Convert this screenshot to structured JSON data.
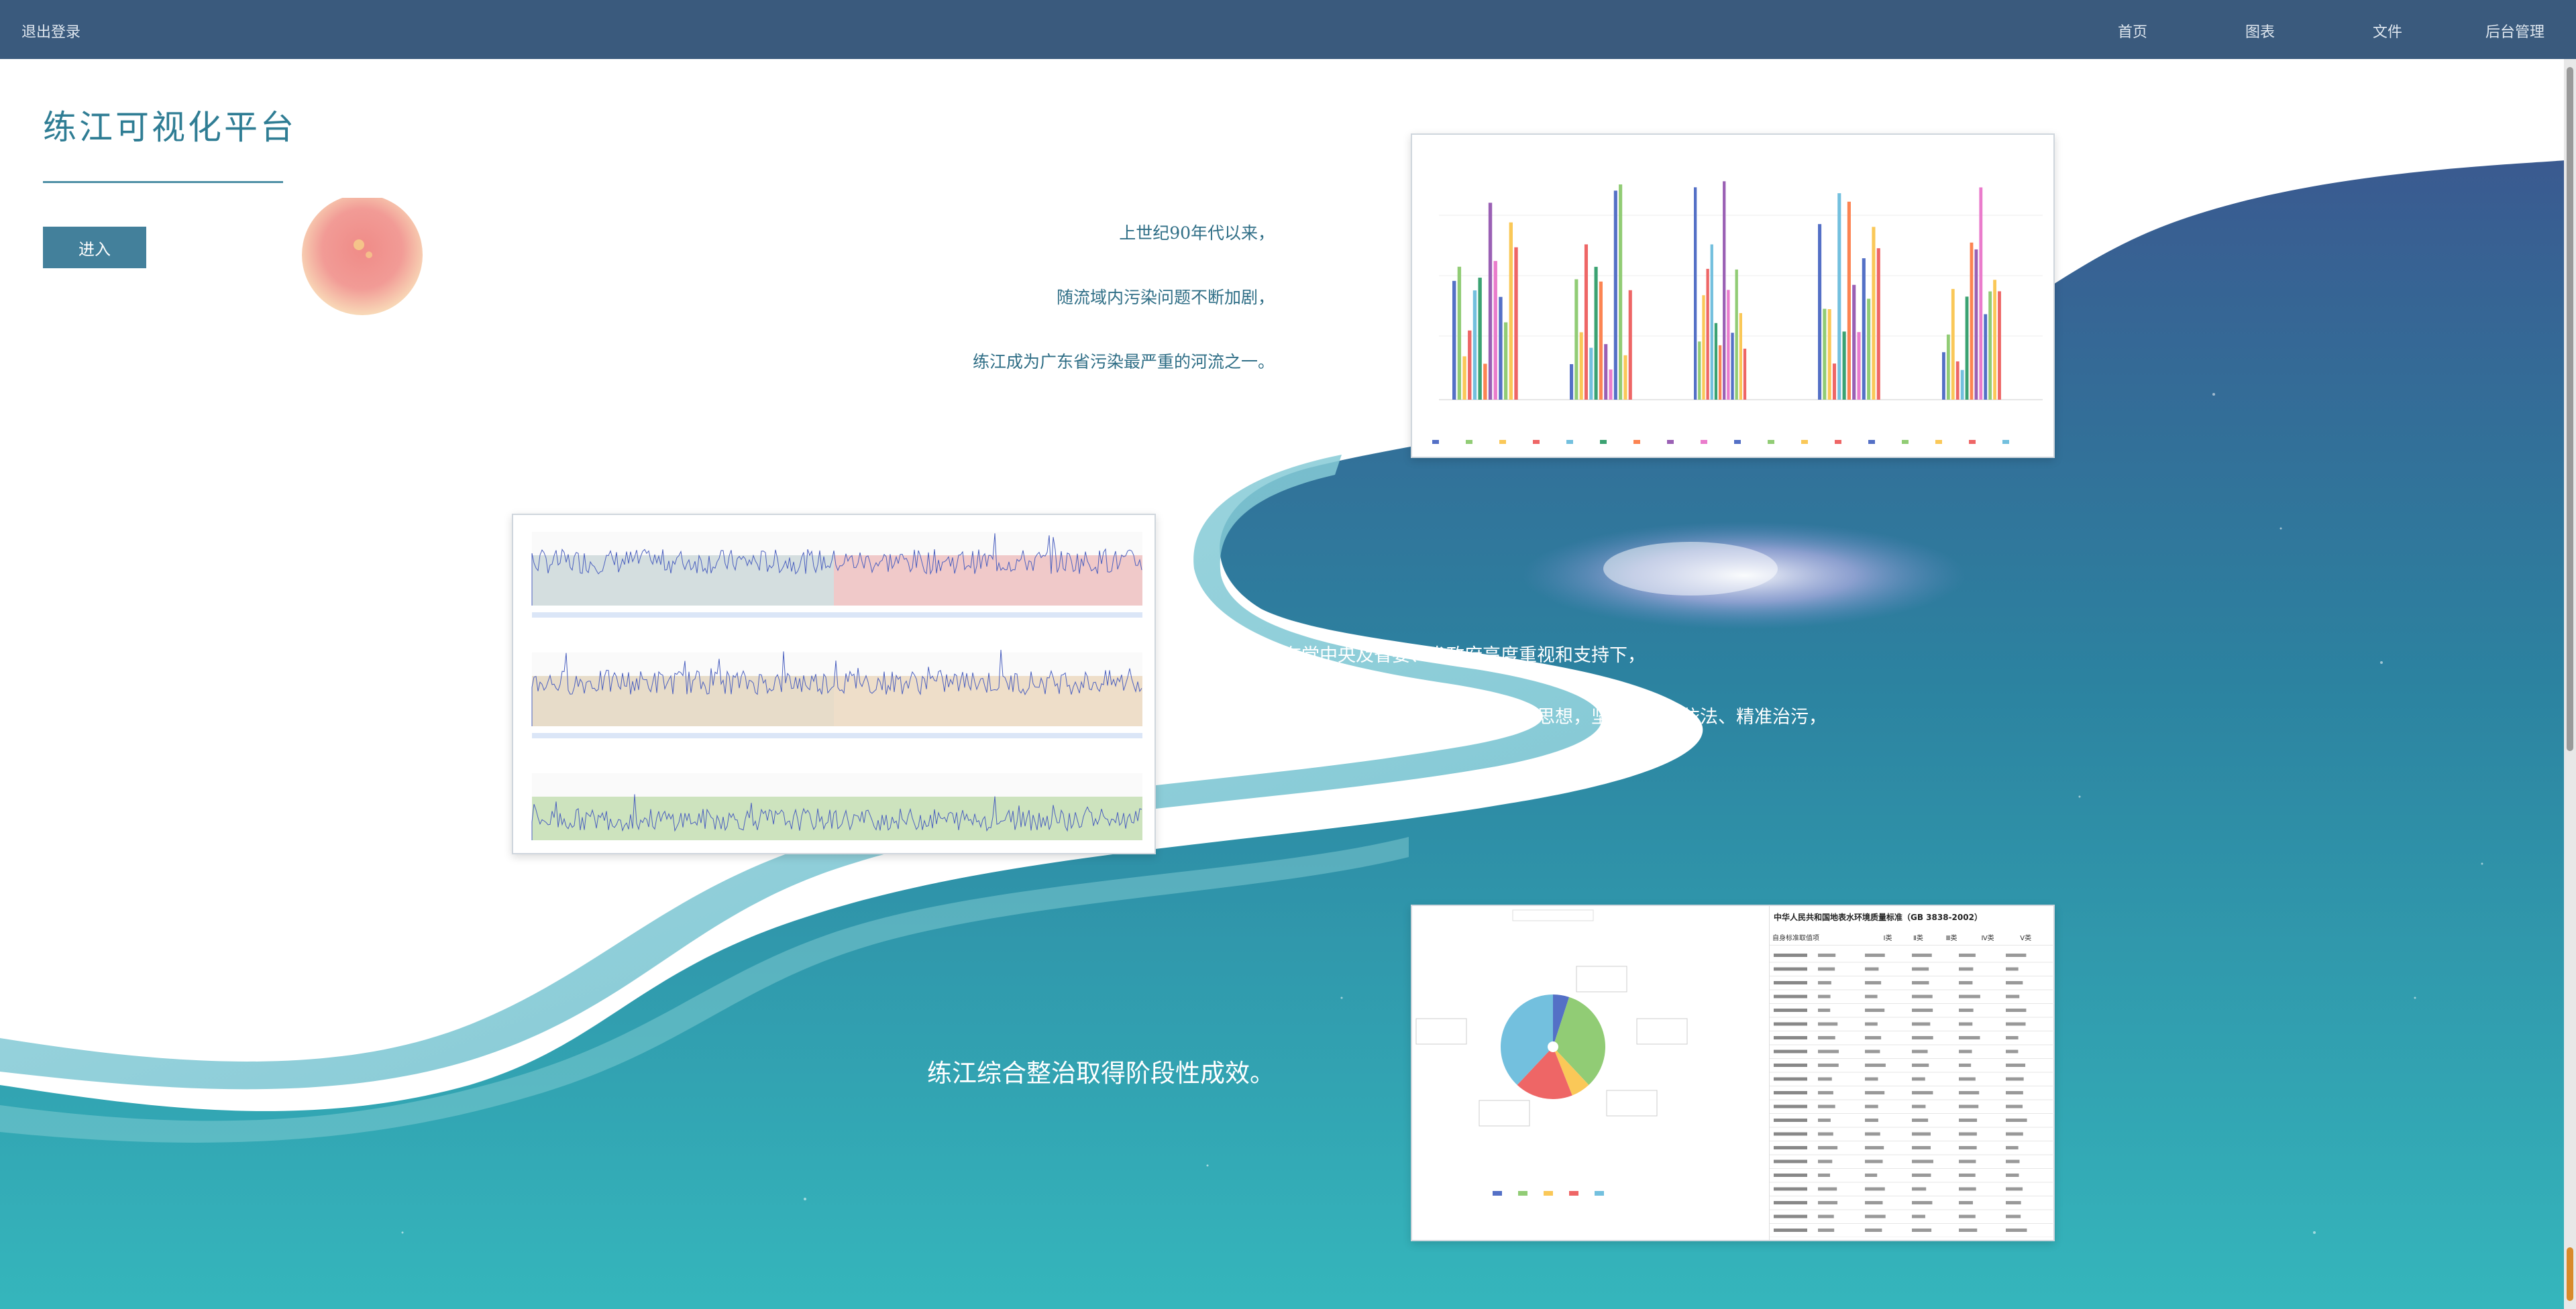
{
  "topbar": {
    "logout": "退出登录",
    "nav": [
      "首页",
      "图表",
      "文件",
      "后台管理"
    ]
  },
  "hero": {
    "title": "练江可视化平台",
    "enter": "进入"
  },
  "intro_lines": [
    "上世纪90年代以来，",
    "随流域内污染问题不断加剧，",
    "练江成为广东省污染最严重的河流之一。"
  ],
  "mid_lines": [
    "在党中央及省委、省政府高度重视和支持下，",
    "汕头市深入践行习近平生态文明思想，坚持科学、依法、精准治污，"
  ],
  "final_line": "练江综合整治取得阶段性成效。",
  "table": {
    "title": "中华人民共和国地表水环境质量标准（GB 3838-2002）",
    "header": [
      "自身标准取值项",
      "Ⅰ类",
      "Ⅱ类",
      "Ⅲ类",
      "Ⅳ类",
      "Ⅴ类"
    ]
  },
  "colors": {
    "topbar": "#3a5a7d",
    "accent": "#2f7d94",
    "button": "#43809b"
  }
}
